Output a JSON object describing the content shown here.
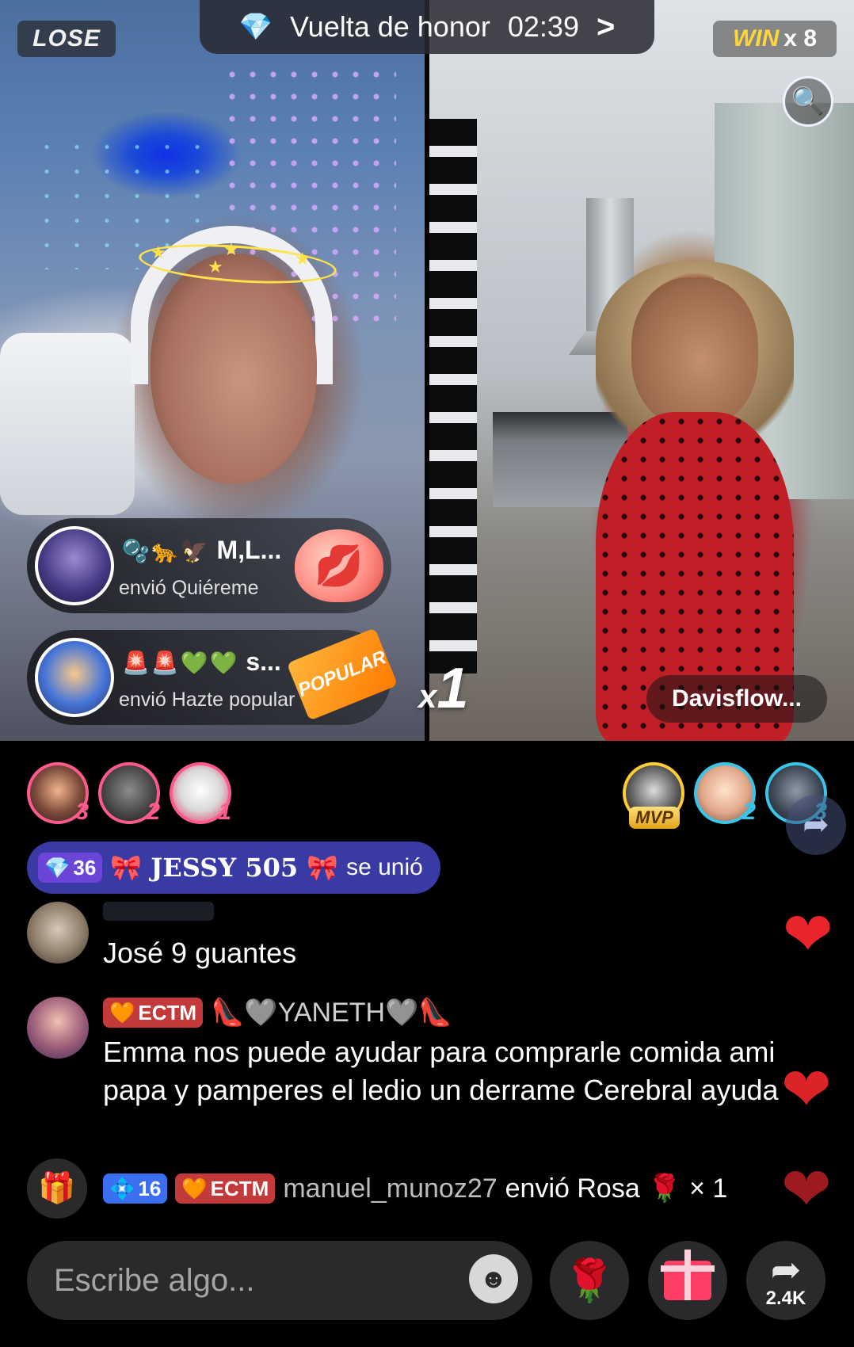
{
  "battle": {
    "left_result": "LOSE",
    "right_result": "WIN",
    "right_multiplier": "x 8",
    "honor_label": "Vuelta de honor",
    "timer": "02:39"
  },
  "gifts": [
    {
      "sender_emojis": "🫧🐆🦅",
      "sender_name": "M,L...",
      "message": "envió Quiéreme"
    },
    {
      "sender_emojis": "🚨🚨💚💚",
      "sender_name": "s...",
      "message": "envió Hazte popular",
      "art_label": "POPULAR"
    }
  ],
  "combo": {
    "prefix": "x",
    "count": "1"
  },
  "opponent_name": "Davisflow...",
  "ranking": {
    "left": [
      {
        "rank": "3"
      },
      {
        "rank": "2"
      },
      {
        "rank": "1"
      }
    ],
    "right": [
      {
        "badge": "MVP"
      },
      {
        "rank": "2"
      },
      {
        "rank": "3"
      }
    ]
  },
  "chat": {
    "join": {
      "level": "36",
      "name": "🎀 JESSY 505 🎀",
      "action": "se unió"
    },
    "messages": [
      {
        "text": "José 9 guantes"
      },
      {
        "badge": "ECTM",
        "user": "👠🩶YANETH🩶👠",
        "text": "Emma nos puede ayudar para comprarle comida ami papa y pamperes el ledio un derrame Cerebral ayuda"
      }
    ],
    "gift_line": {
      "level": "16",
      "badge": "ECTM",
      "user": "manuel_munoz27",
      "action": "envió Rosa",
      "gift_emoji": "🌹",
      "count": "× 1"
    }
  },
  "input": {
    "placeholder": "Escribe algo..."
  },
  "share_count": "2.4K",
  "colors": {
    "accent_pink": "#ff3e66",
    "win_yellow": "#ffd636",
    "join_banner": "#3a3aa5",
    "heart_red": "#e8252b"
  },
  "icons": [
    "diamond-icon",
    "chevron-right-icon",
    "magnifier-icon",
    "share-icon",
    "gift-icon",
    "emoji-icon",
    "rose-icon",
    "heart-icon"
  ]
}
